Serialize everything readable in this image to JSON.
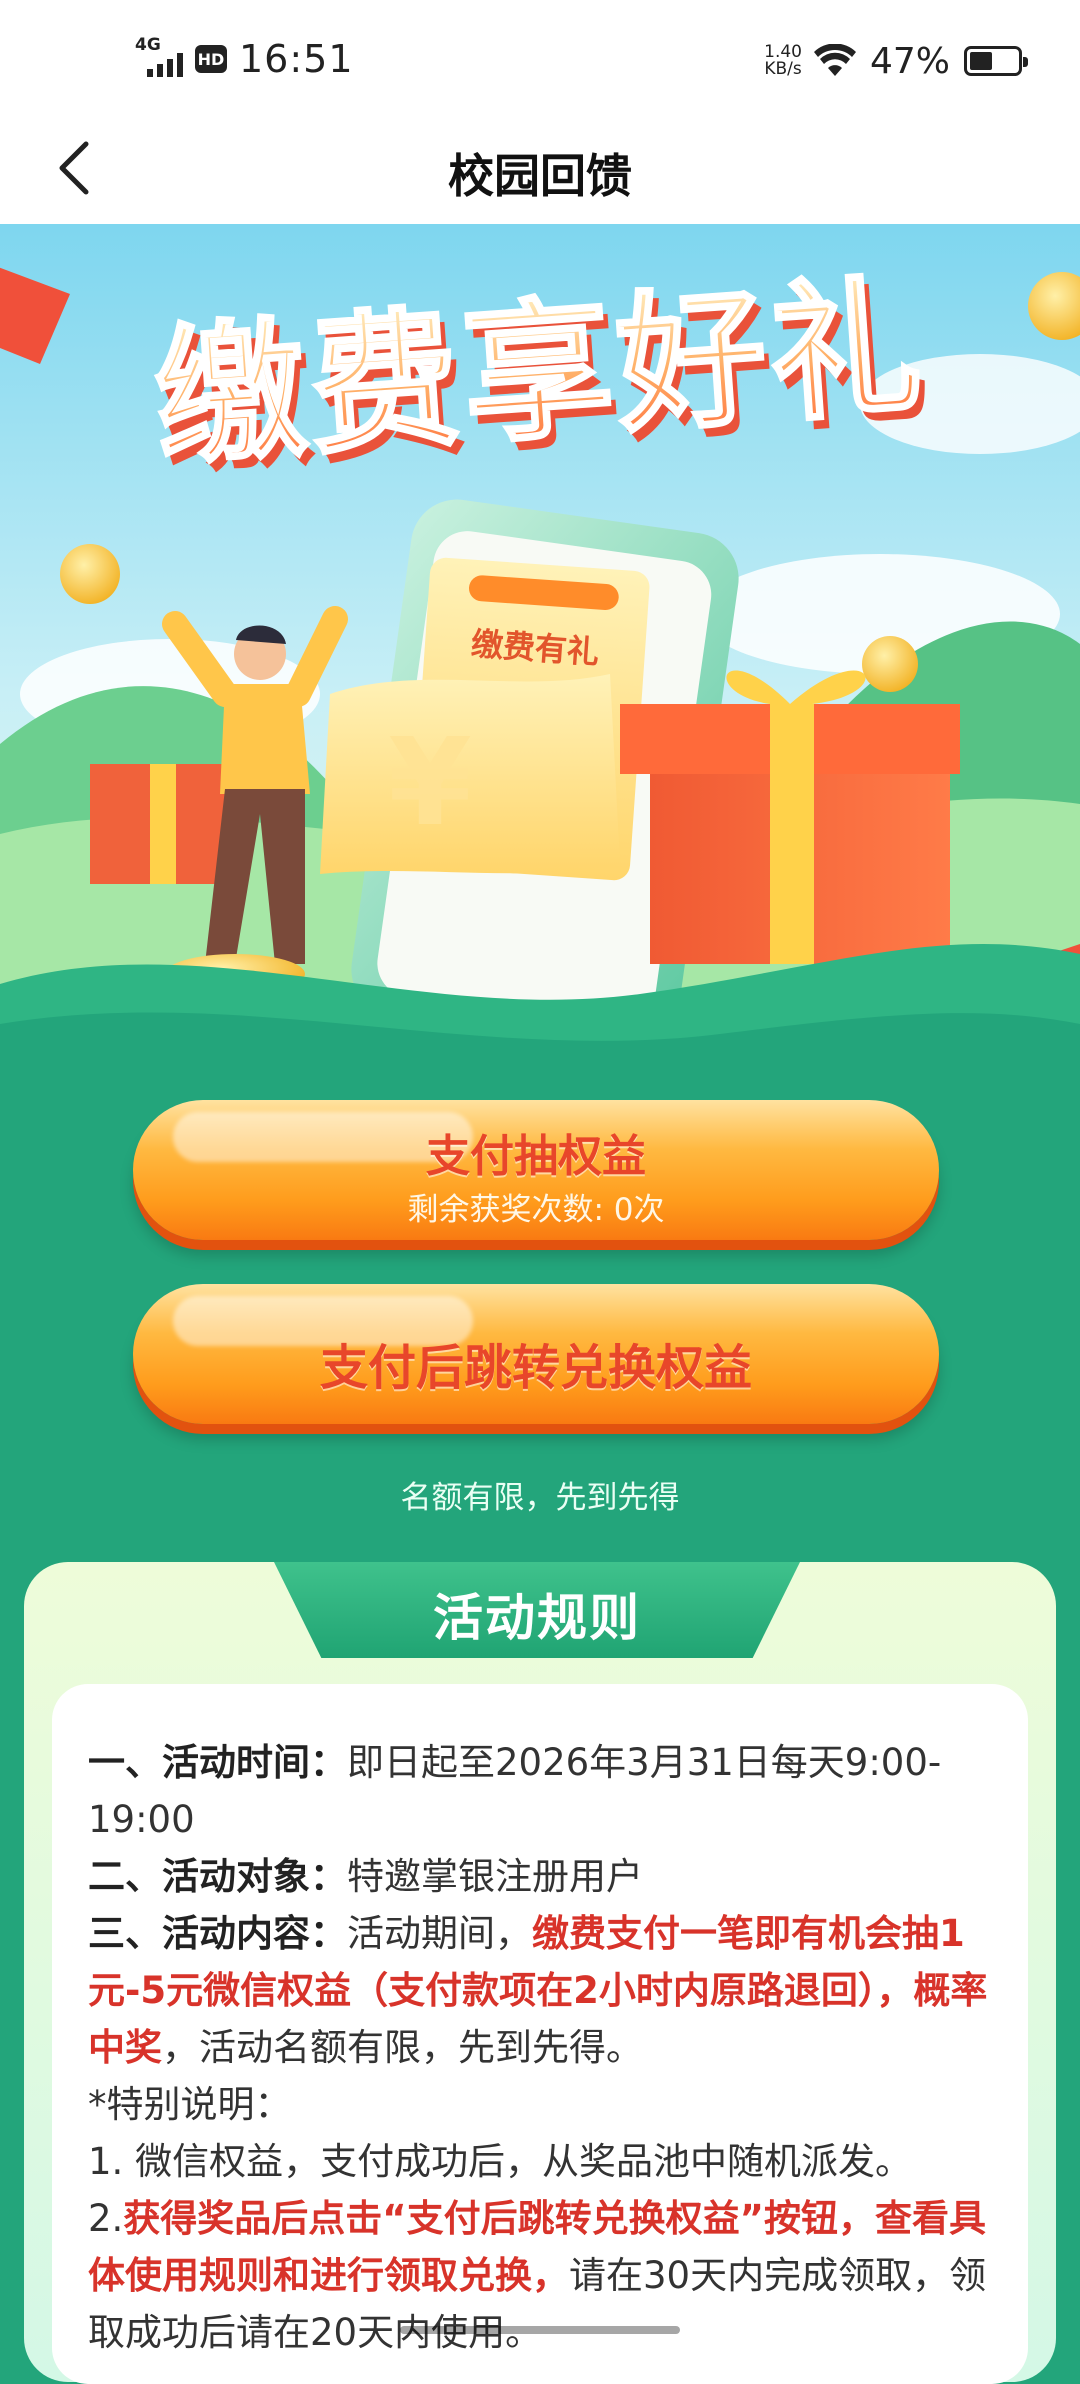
{
  "status_bar": {
    "network": "4G",
    "hd": "HD",
    "time": "16:51",
    "speed_value": "1.40",
    "speed_unit": "KB/s",
    "battery_percent": "47%",
    "battery_level": 0.47,
    "icons": [
      "signal-icon",
      "hd-icon",
      "wifi-icon",
      "battery-icon"
    ]
  },
  "nav": {
    "title": "校园回馈",
    "back_icon": "chevron-left-icon"
  },
  "banner": {
    "headline": "缴费享好礼",
    "receipt_label": "缴费有礼",
    "receipt_symbol": "¥",
    "coin_symbol": "¥"
  },
  "actions": {
    "draw": {
      "label": "支付抽权益",
      "remaining": "剩余获奖次数: 0次"
    },
    "redeem": {
      "label": "支付后跳转兑换权益"
    },
    "limit_note": "名额有限，先到先得"
  },
  "rules": {
    "title": "活动规则",
    "time_label": "一、活动时间：",
    "time_value": "即日起至2026年3月31日每天9:00-19:00",
    "target_label": "二、活动对象：",
    "target_value": "特邀掌银注册用户",
    "content_label": "三、活动内容：",
    "content_prefix": "活动期间，",
    "content_highlight": "缴费支付一笔即有机会抽1元-5元微信权益（支付款项在2小时内原路退回），概率中奖",
    "content_suffix": "，活动名额有限，先到先得。",
    "special_title": "*特别说明：",
    "item1": "1. 微信权益，支付成功后，从奖品池中随机派发。",
    "item2_prefix": "2.",
    "item2_highlight": "获得奖品后点击“支付后跳转兑换权益”按钮，查看具体使用规则和进行领取兑换，",
    "item2_suffix": "请在30天内完成领取，领取成功后请在20天内使用。"
  },
  "colors": {
    "page_green": "#23a57b",
    "button_orange": "#ff9c1c",
    "button_text": "#e8462a",
    "highlight_red": "#d8332a"
  }
}
